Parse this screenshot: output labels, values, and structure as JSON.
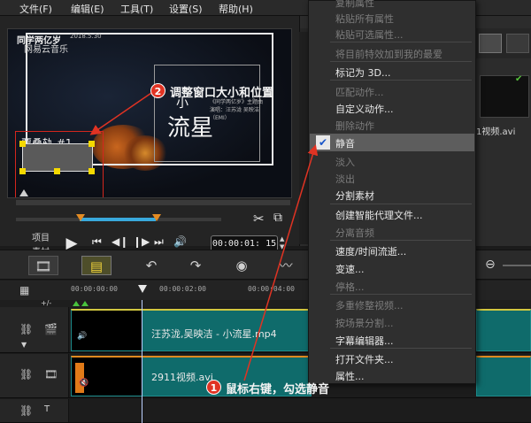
{
  "menubar": {
    "items": [
      "文件(F)",
      "编辑(E)",
      "工具(T)",
      "设置(S)",
      "帮助(H)"
    ]
  },
  "video": {
    "brand": "同学两亿岁",
    "brand_date": "2018.5.30",
    "brand_sub": "网易云音乐",
    "song_title_small": "小",
    "song_title_large": "流星",
    "credits": "《同学两亿岁》主题曲  演唱：汪苏泷  吴映洁（EMI）",
    "pip_label": "覆叠轨  #1"
  },
  "player": {
    "project_label": "项目",
    "clip_label": "素材",
    "timecode": "00:00:01:15",
    "timecode_short": "00:00:01: 15"
  },
  "library": {
    "clip_name": "1视频.avi"
  },
  "timeline": {
    "ruler": [
      "00:00:00:00",
      "00:00:02:00",
      "00:00:04:00"
    ],
    "add_track": "+/-",
    "video_clip_title": "汪苏泷,吴映洁 - 小流星.mp4",
    "overlay_clip_title": "2911视频.avi"
  },
  "context_menu": {
    "items": [
      {
        "label": "复制属性",
        "enabled": false
      },
      {
        "label": "粘贴所有属性",
        "enabled": false
      },
      {
        "label": "粘贴可选属性...",
        "enabled": false
      },
      {
        "label": "将目前特效加到我的最爱",
        "enabled": false
      },
      {
        "label": "标记为 3D...",
        "enabled": true
      },
      {
        "label": "匹配动作...",
        "enabled": false
      },
      {
        "label": "自定义动作...",
        "enabled": true
      },
      {
        "label": "删除动作",
        "enabled": false
      },
      {
        "label": "静音",
        "enabled": true,
        "checked": true
      },
      {
        "label": "淡入",
        "enabled": false
      },
      {
        "label": "淡出",
        "enabled": false
      },
      {
        "label": "分割素材",
        "enabled": true
      },
      {
        "label": "创建智能代理文件...",
        "enabled": true
      },
      {
        "label": "分离音频",
        "enabled": false
      },
      {
        "label": "速度/时间流逝...",
        "enabled": true
      },
      {
        "label": "变速...",
        "enabled": true
      },
      {
        "label": "停格...",
        "enabled": false
      },
      {
        "label": "多重修整视频...",
        "enabled": false
      },
      {
        "label": "按场景分割...",
        "enabled": false
      },
      {
        "label": "字幕编辑器...",
        "enabled": true
      },
      {
        "label": "打开文件夹...",
        "enabled": true
      },
      {
        "label": "属性...",
        "enabled": true
      }
    ]
  },
  "annotations": {
    "step1_number": "1",
    "step1_text": "鼠标右键，勾选静音",
    "step2_number": "2",
    "step2_text": "调整窗口大小和位置",
    "arrow_color": "#e03323"
  },
  "colors": {
    "clip": "#0f6b6b",
    "accent_blue": "#39a9dc",
    "trim_handle": "#e38b23"
  }
}
